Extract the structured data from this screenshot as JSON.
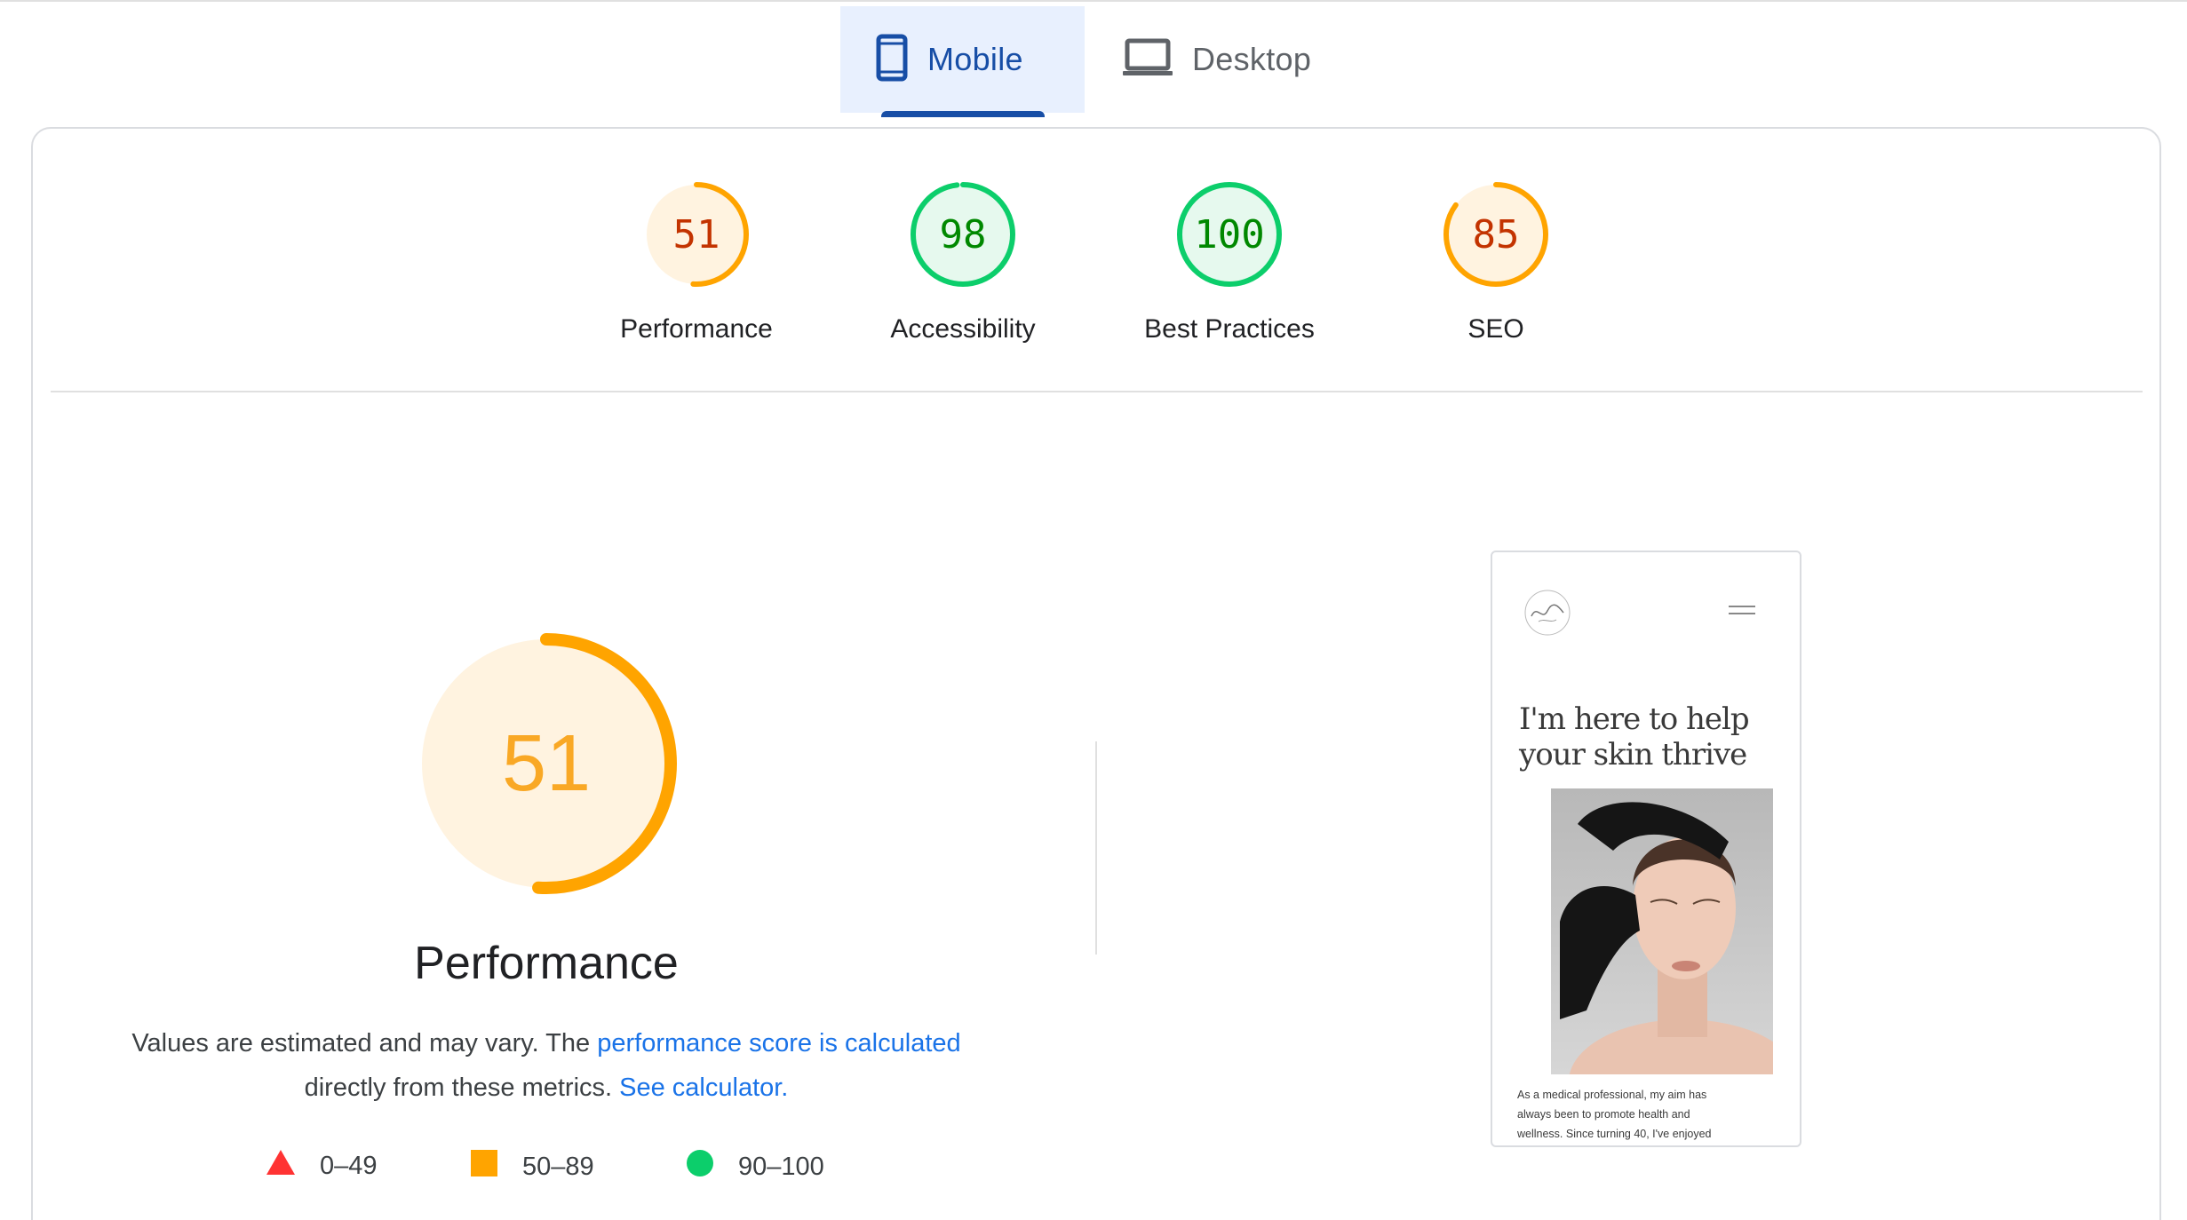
{
  "tabs": [
    {
      "label": "Mobile",
      "icon": "smartphone-icon",
      "selected": true
    },
    {
      "label": "Desktop",
      "icon": "laptop-icon",
      "selected": false
    }
  ],
  "categories": [
    {
      "label": "Performance",
      "score": 51,
      "rating": "average"
    },
    {
      "label": "Accessibility",
      "score": 98,
      "rating": "pass"
    },
    {
      "label": "Best Practices",
      "score": 100,
      "rating": "pass"
    },
    {
      "label": "SEO",
      "score": 85,
      "rating": "average"
    }
  ],
  "performance": {
    "score": 51,
    "title": "Performance",
    "desc_prefix": "Values are estimated and may vary. The ",
    "desc_link1": "performance score is calculated",
    "desc_middle": "directly from these metrics. ",
    "desc_link2": "See calculator."
  },
  "legend": [
    {
      "shape": "triangle",
      "range": "0–49",
      "color": "#ff3333"
    },
    {
      "shape": "square",
      "range": "50–89",
      "color": "#ffa400"
    },
    {
      "shape": "circle",
      "range": "90–100",
      "color": "#0cce6b"
    }
  ],
  "screenshot": {
    "headline_line1": "I'm here to help",
    "headline_line2": "your skin thrive",
    "body_line1": "As a medical professional, my aim has",
    "body_line2": "always been to promote health and",
    "body_line3": "wellness. Since turning 40, I've enjoyed"
  },
  "colors": {
    "average_stroke": "#ffa400",
    "average_fill": "#fff3e0",
    "average_text": "#c33300",
    "pass_stroke": "#0cce6b",
    "pass_fill": "#e6f9ee",
    "pass_text": "#008800",
    "accent": "#174ea6",
    "link": "#1a73e8"
  }
}
